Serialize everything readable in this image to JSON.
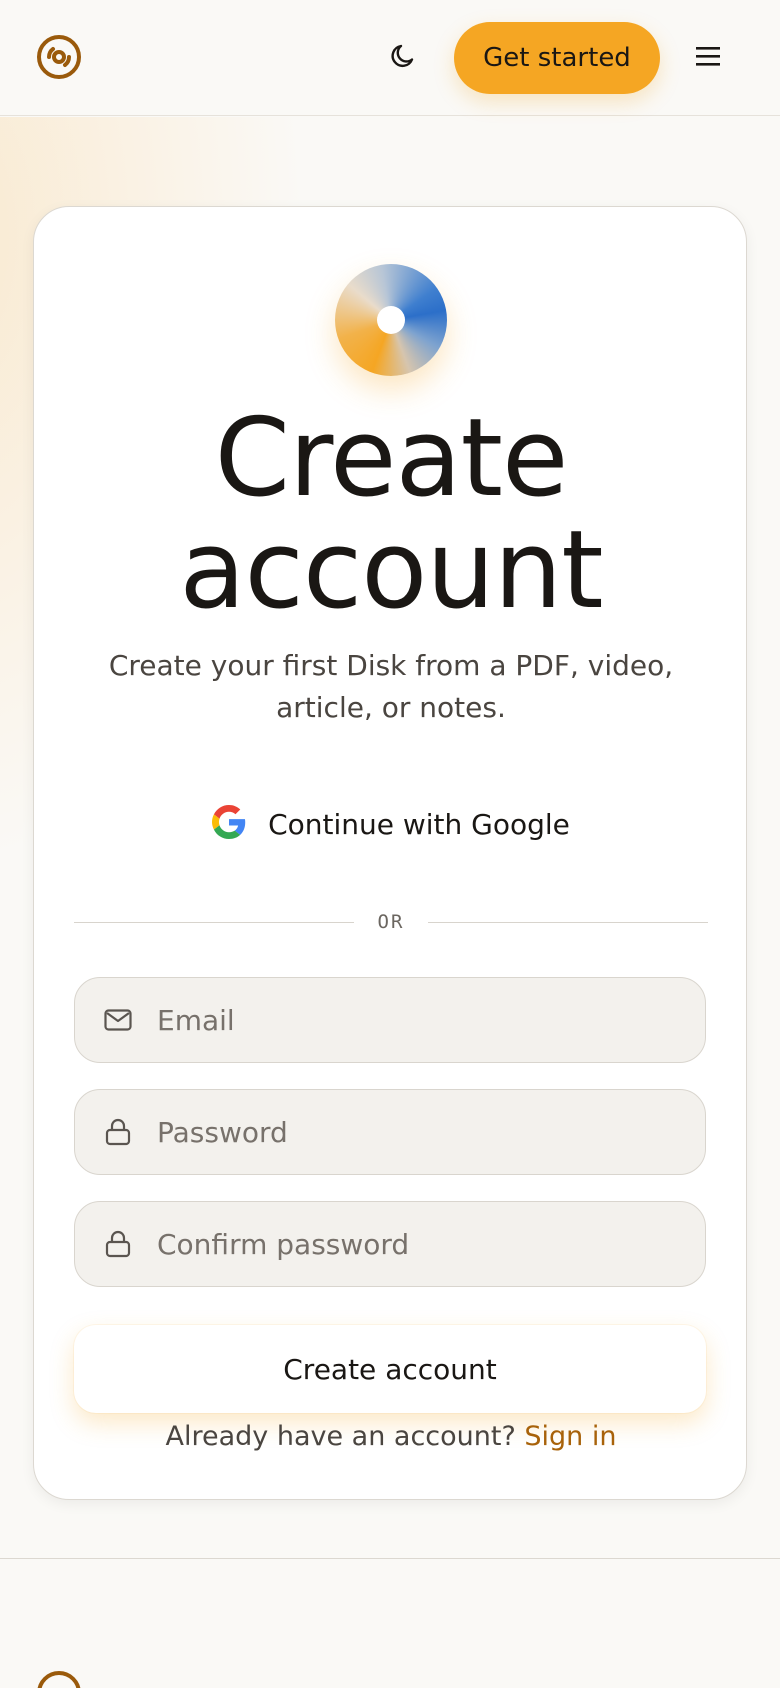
{
  "header": {
    "logo_icon": "disc-logo-icon",
    "theme_icon": "moon-icon",
    "cta_label": "Get started",
    "menu_icon": "hamburger-menu-icon"
  },
  "card": {
    "hero_icon": "gradient-disc-icon",
    "title_line1": "Create",
    "title_line2": "account",
    "subtitle": "Create your first Disk from a PDF, video, article, or notes.",
    "google_label": "Continue with Google",
    "divider_text": "OR",
    "email_placeholder": "Email",
    "password_placeholder": "Password",
    "confirm_placeholder": "Confirm password",
    "submit_label": "Create account",
    "signin_prompt": "Already have an account?",
    "signin_link": "Sign in"
  },
  "colors": {
    "accent": "#f5a623",
    "link": "#a8620a",
    "logo": "#9a5a0b"
  }
}
